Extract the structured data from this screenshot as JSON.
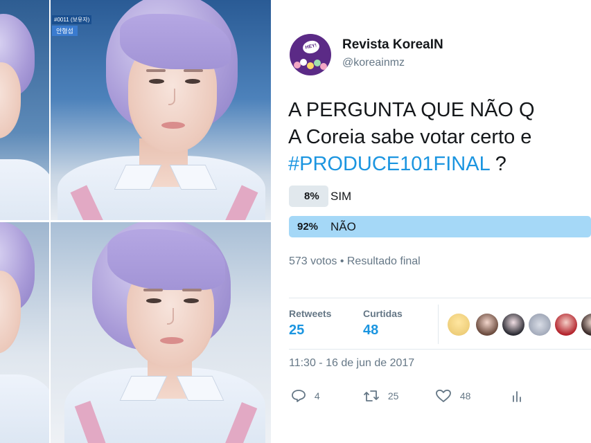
{
  "collage": {
    "broadcast_tag_line1": "#0011 (보유자)",
    "broadcast_tag_line2": "안형섭"
  },
  "tweet": {
    "author_name": "Revista KoreaIN",
    "author_handle": "@koreainmz",
    "avatar_badge": "HEY!",
    "text_line1": "A PERGUNTA QUE NÃO Q",
    "text_line2": "A Coreia sabe votar certo e",
    "hashtag": "#PRODUCE101FINAL",
    "text_line3_suffix": " ?",
    "poll": [
      {
        "percent": "8%",
        "label": "SIM",
        "fraction": 0.08
      },
      {
        "percent": "92%",
        "label": "NÃO",
        "fraction": 0.92
      }
    ],
    "poll_meta": "573 votos • Resultado final",
    "retweets_label": "Retweets",
    "retweets_count": "25",
    "likes_label": "Curtidas",
    "likes_count": "48",
    "timestamp": "11:30 - 16 de jun de 2017",
    "reply_count": "4",
    "retweet_action_count": "25",
    "like_action_count": "48"
  },
  "colors": {
    "accent": "#1b95e0",
    "poll_winner": "#a5d8f7",
    "poll_loser": "#e1e8ed",
    "secondary_text": "#657786"
  }
}
